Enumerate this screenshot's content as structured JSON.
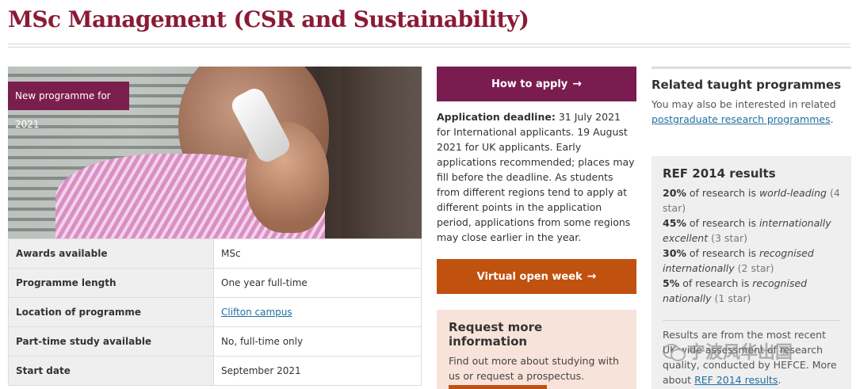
{
  "page": {
    "title": "MSc Management (CSR and Sustainability)"
  },
  "hero": {
    "badge": "New programme for 2021"
  },
  "facts": [
    {
      "label": "Awards available",
      "value": "MSc"
    },
    {
      "label": "Programme length",
      "value": "One year full-time"
    },
    {
      "label": "Location of programme",
      "value": "Clifton campus",
      "is_link": true
    },
    {
      "label": "Part-time study available",
      "value": "No, full-time only"
    },
    {
      "label": "Start date",
      "value": "September 2021"
    }
  ],
  "apply": {
    "button_label": "How to apply",
    "deadline_label": "Application deadline:",
    "deadline_text": "31 July 2021 for International applicants. 19 August 2021 for UK applicants. Early applications recommended; places may fill before the deadline. As students from different regions tend to apply at different points in the application period, applications from some regions may close earlier in the year."
  },
  "open_week": {
    "button_label": "Virtual open week"
  },
  "request": {
    "heading": "Request more information",
    "text": "Find out more about studying with us or request a prospectus."
  },
  "related": {
    "heading": "Related taught programmes",
    "text": "You may also be interested in related",
    "link": "postgraduate research programmes",
    "suffix": "."
  },
  "ref": {
    "heading": "REF 2014 results",
    "items": [
      {
        "pct": "20%",
        "mid": "of research is",
        "rating": "world-leading",
        "stars": "(4 star)"
      },
      {
        "pct": "45%",
        "mid": "of research is",
        "rating": "internationally excellent",
        "stars": "(3 star)"
      },
      {
        "pct": "30%",
        "mid": "of research is",
        "rating": "recognised internationally",
        "stars": "(2 star)"
      },
      {
        "pct": "5%",
        "mid": "of research is",
        "rating": "recognised nationally",
        "stars": "(1 star)"
      }
    ],
    "note_text": "Results are from the most recent UK-wide assessment of research quality, conducted by HEFCE. More about",
    "note_link": "REF 2014 results",
    "note_suffix": "."
  },
  "watermark": {
    "text": "宁波风华出国"
  },
  "colors": {
    "title": "#8b1a35",
    "apply": "#7b1c50",
    "open_week": "#c0510f",
    "link": "#1f6fa3",
    "request_bg": "#f8e3da",
    "ref_bg": "#efefef"
  },
  "icons": {
    "apply_arrow": "→",
    "open_week_arrow": "→"
  }
}
